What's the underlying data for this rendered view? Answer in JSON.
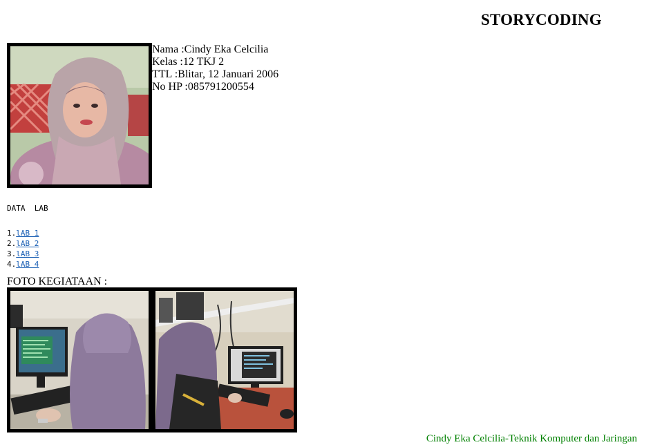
{
  "header": {
    "title": "STORYCODING"
  },
  "profile": {
    "photo_alt": "profile-photo",
    "name_label": "Nama :",
    "name": "Cindy Eka Celcilia",
    "class_label": "Kelas :",
    "class": "12 TKJ 2",
    "birth_label": "TTL :",
    "birth": "Blitar, 12 Januari 2006",
    "phone_label": "No HP :",
    "phone": "085791200554"
  },
  "lab": {
    "heading": "DATA  LAB",
    "items": [
      {
        "num": "1.",
        "label": "lAB 1"
      },
      {
        "num": "2.",
        "label": "lAB 2"
      },
      {
        "num": "3.",
        "label": "lAB 3"
      },
      {
        "num": "4.",
        "label": "lAB 4"
      }
    ]
  },
  "activities": {
    "label": "FOTO KEGIATAAN :"
  },
  "footer": {
    "text": "Cindy Eka Celcilia-Teknik Komputer dan Jaringan"
  },
  "colors": {
    "footer_text": "#008000",
    "link": "#1a5fb4",
    "frame": "#000000"
  }
}
